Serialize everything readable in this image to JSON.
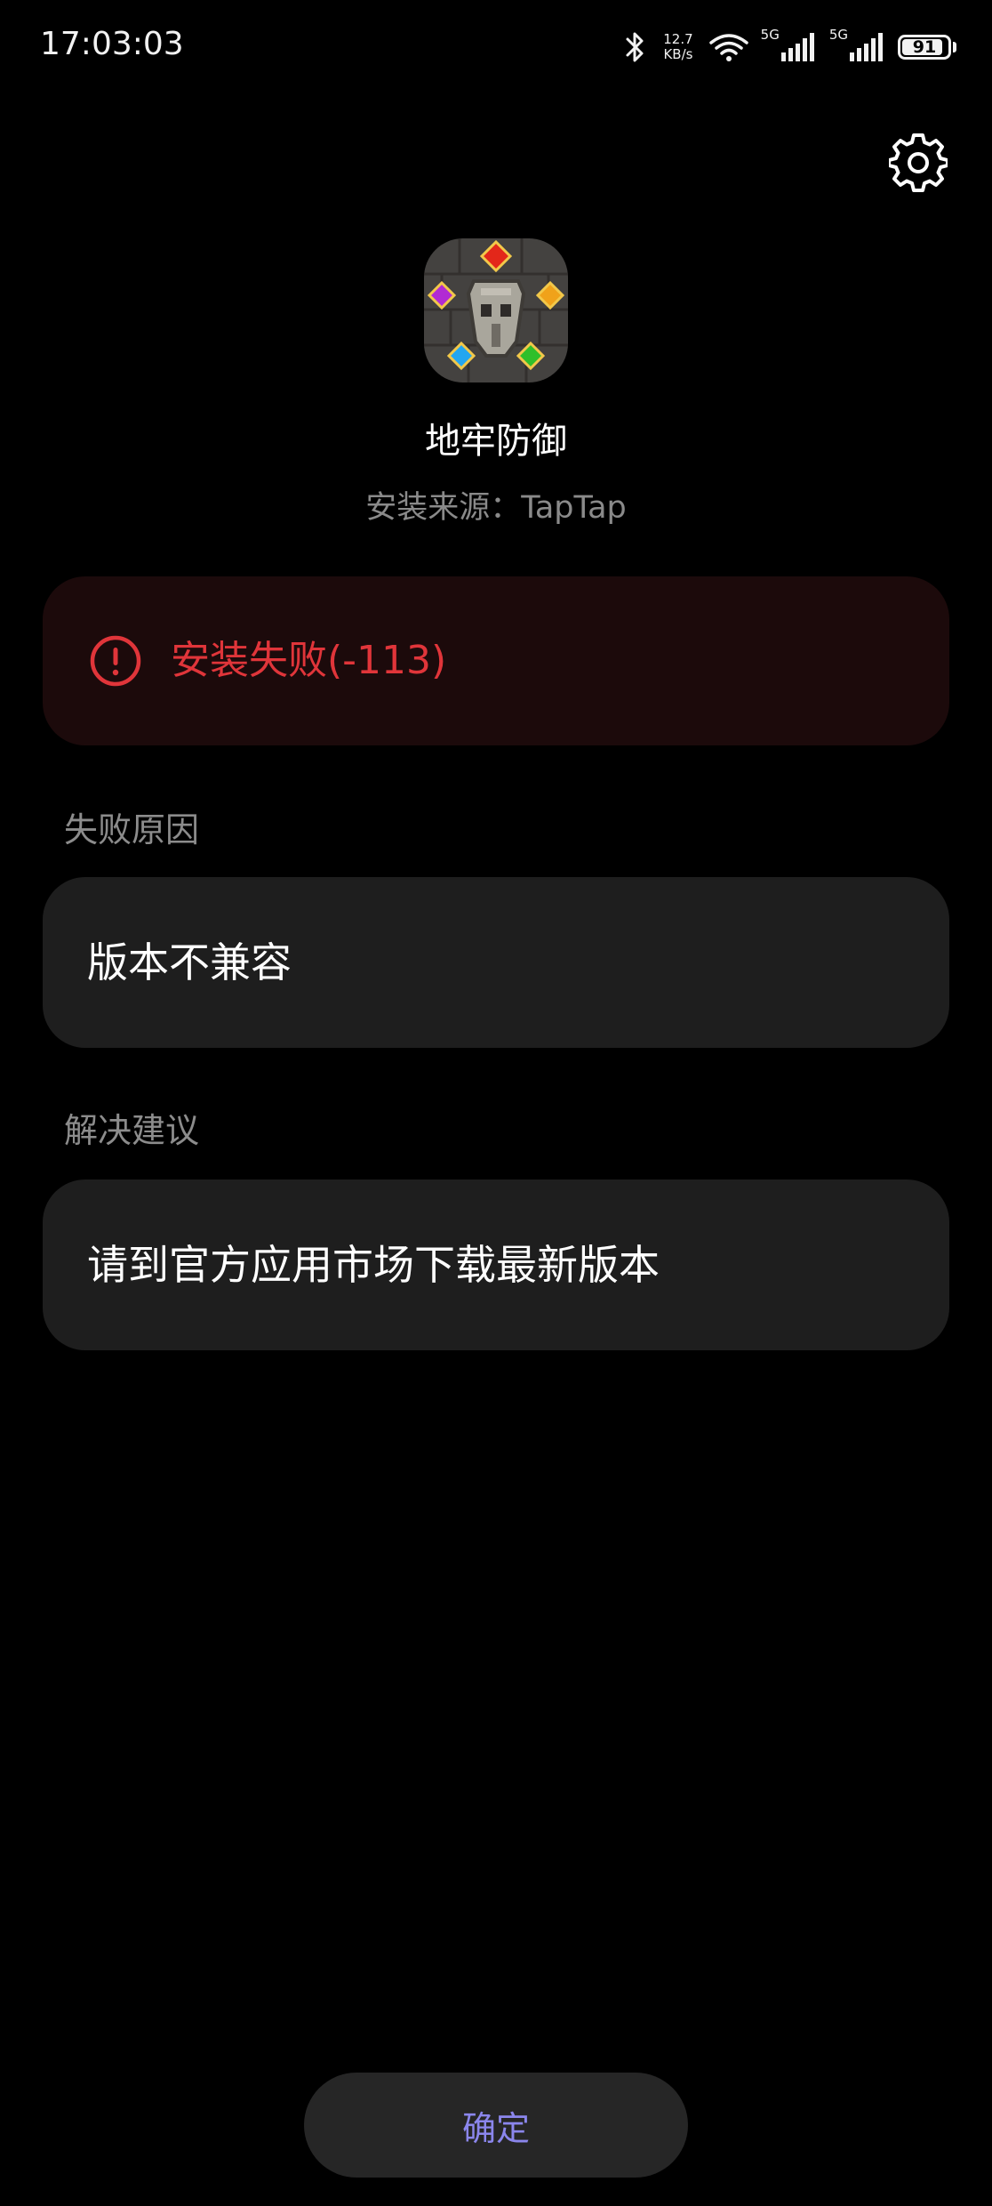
{
  "status_bar": {
    "time": "17:03:03",
    "net_speed_value": "12.7",
    "net_speed_unit": "KB/s",
    "sim1_label": "5G",
    "sim2_label": "5G",
    "battery_level": "91",
    "battery_fraction": 0.91,
    "icons": [
      "bluetooth-icon",
      "wifi-icon",
      "signal-icon",
      "battery-icon"
    ]
  },
  "header": {
    "settings_icon": "gear-icon",
    "app_icon": "app-icon-dungeon-defense",
    "app_name": "地牢防御",
    "install_source": "安装来源：TapTap"
  },
  "error": {
    "icon": "error-icon",
    "message": "安装失败(-113)",
    "color": "#e0353a"
  },
  "failure_reason": {
    "label": "失败原因",
    "value": "版本不兼容"
  },
  "solution": {
    "label": "解决建议",
    "value": "请到官方应用市场下载最新版本"
  },
  "actions": {
    "confirm_label": "确定",
    "accent_color": "#8b86ec"
  }
}
